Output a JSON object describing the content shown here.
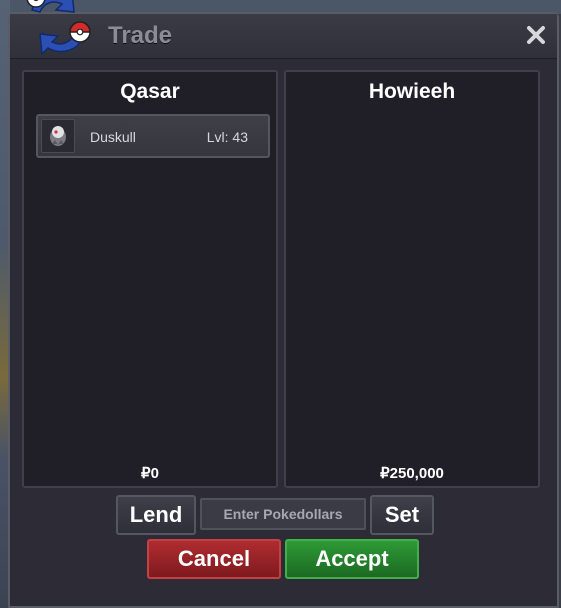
{
  "window": {
    "title": "Trade",
    "close_icon": "close-icon",
    "logo_icon": "trade-pokeball-arrows-icon"
  },
  "left_panel": {
    "player_name": "Qasar",
    "items": [
      {
        "icon": "duskull-sprite-icon",
        "name": "Duskull",
        "level": "Lvl: 43"
      }
    ],
    "money": "₽0"
  },
  "right_panel": {
    "player_name": "Howieeh",
    "items": [],
    "money": "₽250,000"
  },
  "controls": {
    "lend_label": "Lend",
    "money_placeholder": "Enter Pokedollars",
    "set_label": "Set",
    "cancel_label": "Cancel",
    "accept_label": "Accept"
  },
  "colors": {
    "cancel": "#9a2328",
    "accept": "#27832e",
    "panel_bg": "#201f28",
    "window_bg": "#2c2b36"
  }
}
